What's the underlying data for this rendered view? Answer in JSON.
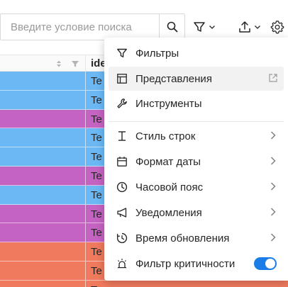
{
  "search": {
    "placeholder": "Введите условие поиска",
    "value": ""
  },
  "toolbar": {
    "search_icon": "search-icon",
    "filter_icon": "filter-icon",
    "export_icon": "export-icon",
    "settings_icon": "gear-icon"
  },
  "table": {
    "header_col2": "ide",
    "row_cell_text": "Te",
    "row_colors": [
      "#6bb8f5",
      "#6bb8f5",
      "#c563c2",
      "#6bb8f5",
      "#6bb8f5",
      "#c563c2",
      "#6bb8f5",
      "#c563c2",
      "#c563c2",
      "#f07a5e",
      "#f07a5e",
      "#f07a5e"
    ],
    "rows": [
      "Te",
      "Te",
      "Te",
      "Te",
      "Te",
      "Te",
      "Te",
      "Te",
      "Te",
      "Te",
      "Te",
      "Te"
    ]
  },
  "menu": {
    "items": [
      {
        "label": "Фильтры",
        "icon": "filter-icon"
      },
      {
        "label": "Представления",
        "icon": "table-view-icon",
        "right_icon": "external-link-icon",
        "highlighted": true
      },
      {
        "label": "Инструменты",
        "icon": "wrench-icon"
      },
      {
        "label": "Стиль строк",
        "icon": "row-height-icon",
        "has_submenu": true
      },
      {
        "label": "Формат даты",
        "icon": "calendar-icon",
        "has_submenu": true
      },
      {
        "label": "Часовой пояс",
        "icon": "clock-icon",
        "has_submenu": true
      },
      {
        "label": "Уведомления",
        "icon": "megaphone-icon",
        "has_submenu": true
      },
      {
        "label": "Время обновления",
        "icon": "refresh-clock-icon",
        "has_submenu": true
      },
      {
        "label": "Фильтр критичности",
        "icon": "alarm-icon",
        "toggle": true,
        "toggle_on": true
      }
    ]
  },
  "colors": {
    "accent": "#1a7ee6",
    "row_blue": "#6bb8f5",
    "row_purple": "#c563c2",
    "row_orange": "#f07a5e"
  }
}
